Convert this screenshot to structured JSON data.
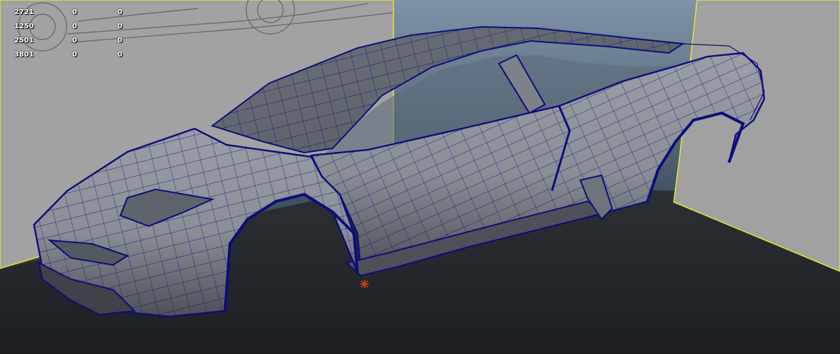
{
  "hud": {
    "rows": [
      [
        "2721",
        "0",
        "0"
      ],
      [
        "1250",
        "0",
        "0"
      ],
      [
        "2501",
        "0",
        "0"
      ],
      [
        "3801",
        "0",
        "0"
      ]
    ]
  },
  "colors": {
    "background_top": "#7f93a8",
    "background_bottom": "#1c1f23",
    "floor": "#2a2e33",
    "image_plane": "#a2a2a2",
    "plane_border": "#e5e52e",
    "surface": "#8c8f96",
    "wireframe": "#0b0f7a",
    "pivot": "#d23a10"
  },
  "icons": {
    "pivot": "pivot-marker-icon"
  }
}
